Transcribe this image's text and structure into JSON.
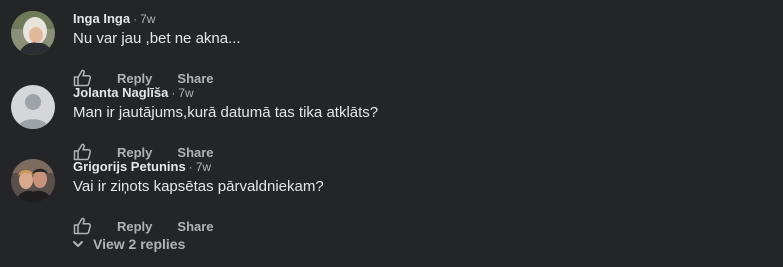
{
  "comments": [
    {
      "author": "Inga Inga",
      "separator": "·",
      "time": "7w",
      "text": "Nu var jau ,bet ne akna...",
      "avatar_icon": "profile-photo",
      "reply_label": "Reply",
      "share_label": "Share",
      "like_icon": "thumbs-up-icon"
    },
    {
      "author": "Jolanta Naglīša",
      "separator": "·",
      "time": "7w",
      "text": "Man ir jautājums,kurā datumā tas tika atklāts?",
      "avatar_icon": "default-profile-icon",
      "reply_label": "Reply",
      "share_label": "Share",
      "like_icon": "thumbs-up-icon"
    },
    {
      "author": "Grigorijs Petunins",
      "separator": "·",
      "time": "7w",
      "text": "Vai ir ziņots kapsētas pārvaldniekam?",
      "avatar_icon": "profile-photo",
      "reply_label": "Reply",
      "share_label": "Share",
      "like_icon": "thumbs-up-icon"
    }
  ],
  "view_replies": {
    "label": "View 2 replies",
    "icon": "chevron-down-icon"
  },
  "colors": {
    "background": "#242526",
    "primary_text": "#e4e6eb",
    "secondary_text": "#b0b3b8"
  }
}
